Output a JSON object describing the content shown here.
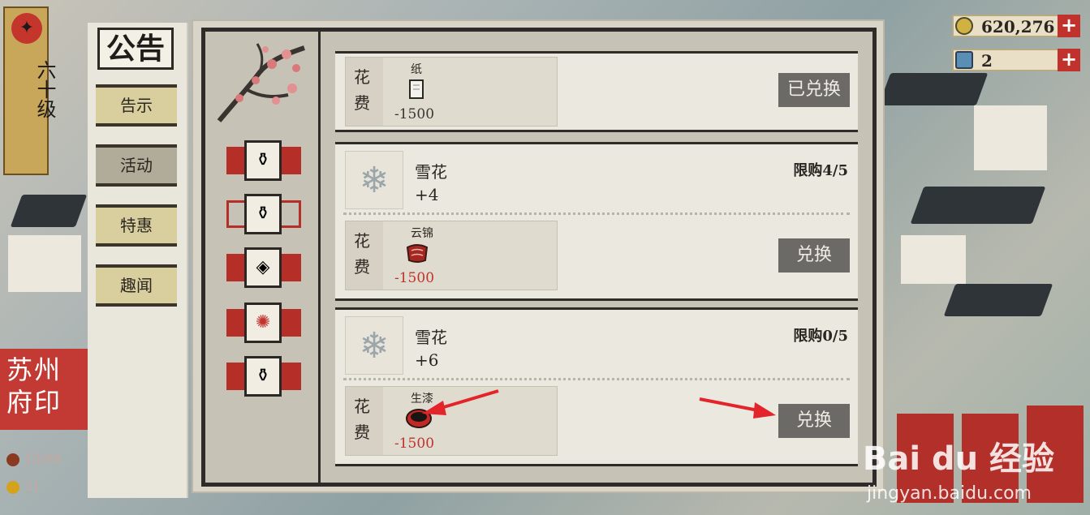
{
  "level": {
    "emblem_icon": "fan-icon",
    "label": "六十级"
  },
  "currency": [
    {
      "icon": "coin-icon",
      "value": "620,276",
      "plus": "+"
    },
    {
      "icon": "gem-icon",
      "value": "2",
      "plus": "+"
    }
  ],
  "menu": {
    "title": "公告",
    "items": [
      {
        "label": "告示",
        "active": false
      },
      {
        "label": "活动",
        "active": true
      },
      {
        "label": "特惠",
        "active": false
      },
      {
        "label": "趣闻",
        "active": false
      }
    ]
  },
  "stamp": {
    "line1": "苏州",
    "line2": "府印",
    "stat1": "15/88",
    "stat2": "21"
  },
  "tabs": [
    {
      "icon": "tank-icon",
      "glyph": "⚱",
      "style": "filled"
    },
    {
      "icon": "tank-icon",
      "glyph": "⚱",
      "style": "outline"
    },
    {
      "icon": "gem-icon",
      "glyph": "◈",
      "style": "filled"
    },
    {
      "icon": "sun-swirl-icon",
      "glyph": "✺",
      "style": "filled"
    },
    {
      "icon": "tank-icon",
      "glyph": "⚱",
      "style": "filled"
    }
  ],
  "rows": [
    {
      "cost_label": "花费",
      "cost_item": "纸",
      "cost_icon": "scroll-icon",
      "cost_glyph": "📜",
      "cost_amount": "-1500",
      "button": "已兑换",
      "amount_color": "#3a3530"
    },
    {
      "reward_name": "雪花",
      "reward_qty": "+4",
      "reward_icon": "snowflake-icon",
      "limit": "限购4/5",
      "cost_label": "花费",
      "cost_item": "云锦",
      "cost_icon": "silk-icon",
      "cost_glyph": "❦",
      "cost_amount": "-1500",
      "button": "兑换",
      "amount_color": "#c0322b"
    },
    {
      "reward_name": "雪花",
      "reward_qty": "+6",
      "reward_icon": "snowflake-icon",
      "limit": "限购0/5",
      "cost_label": "花费",
      "cost_item": "生漆",
      "cost_icon": "lacquer-bowl-icon",
      "cost_glyph": "◉",
      "cost_amount": "-1500",
      "button": "兑换",
      "amount_color": "#c0322b"
    }
  ],
  "watermark": {
    "main": "Bai du 经验",
    "sub": "jingyan.baidu.com"
  },
  "colors": {
    "accent_red": "#b52e28",
    "button_gray": "#6c6a67",
    "gold": "#c8a65a"
  }
}
